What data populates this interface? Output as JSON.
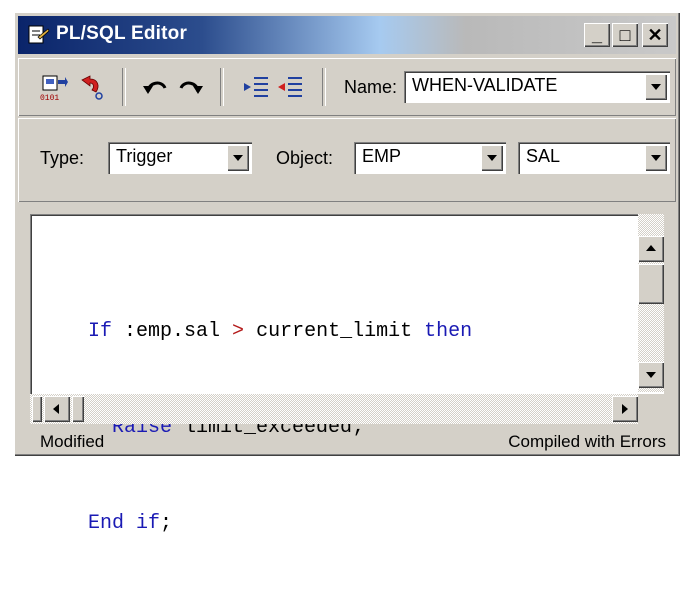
{
  "window": {
    "title": "PL/SQL Editor"
  },
  "title_buttons": {
    "minimize": "_",
    "maximize": "□",
    "close": "✕"
  },
  "toolbar": {
    "icons": [
      "compile-icon",
      "revert-icon",
      "undo-icon",
      "redo-icon",
      "indent-icon",
      "outdent-icon"
    ],
    "name_label": "Name:",
    "name_value": "WHEN-VALIDATE"
  },
  "selectors": {
    "type_label": "Type:",
    "type_value": "Trigger",
    "object_label": "Object:",
    "object_value": "EMP",
    "item_value": "SAL"
  },
  "code": {
    "line1": {
      "kw1": "If",
      "text1": " :emp.sal ",
      "op": ">",
      "text2": " current_limit ",
      "kw2": "then"
    },
    "line2": {
      "indent": "  ",
      "kw": "Raise",
      "text": " limit_exceeded;"
    },
    "line3": {
      "kw": "End if",
      "text": ";"
    }
  },
  "status": {
    "left": "Modified",
    "right": "Compiled with Errors"
  },
  "colors": {
    "keyword": "#1a1ab4",
    "operator": "#b41a1a",
    "face": "#d4d0c8",
    "title_active": "#0a246a"
  }
}
